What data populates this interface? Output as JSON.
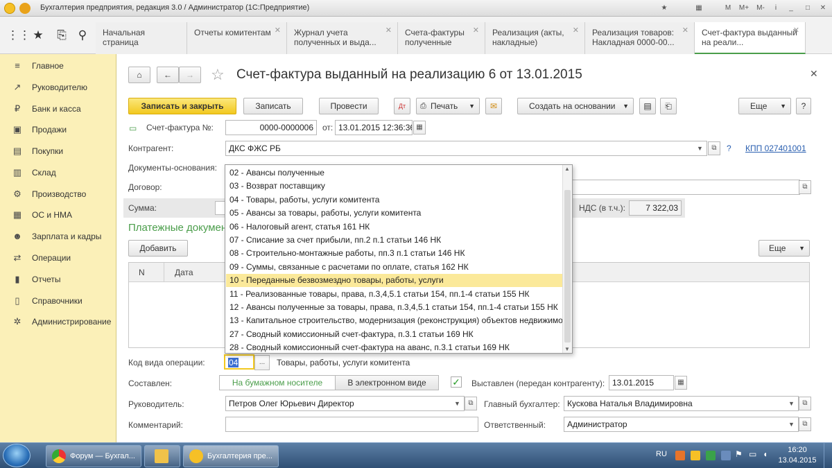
{
  "window": {
    "title": "Бухгалтерия предприятия, редакция 3.0 / Администратор  (1С:Предприятие)",
    "controls": [
      "M",
      "M+",
      "M-"
    ]
  },
  "tabs": [
    {
      "label": "Начальная страница",
      "closable": false
    },
    {
      "label": "Отчеты комитентам",
      "closable": true
    },
    {
      "label": "Журнал учета полученных и выда...",
      "closable": true
    },
    {
      "label": "Счета-фактуры полученные",
      "closable": true
    },
    {
      "label": "Реализация (акты, накладные)",
      "closable": true
    },
    {
      "label": "Реализация товаров: Накладная 0000-00...",
      "closable": true
    },
    {
      "label": "Счет-фактура выданный на реали...",
      "closable": true,
      "active": true
    }
  ],
  "sidebar": {
    "items": [
      {
        "label": "Главное",
        "icon": "list-icon"
      },
      {
        "label": "Руководителю",
        "icon": "chart-icon"
      },
      {
        "label": "Банк и касса",
        "icon": "ruble-icon"
      },
      {
        "label": "Продажи",
        "icon": "cart-icon"
      },
      {
        "label": "Покупки",
        "icon": "basket-icon"
      },
      {
        "label": "Склад",
        "icon": "warehouse-icon"
      },
      {
        "label": "Производство",
        "icon": "factory-icon"
      },
      {
        "label": "ОС и НМА",
        "icon": "building-icon"
      },
      {
        "label": "Зарплата и кадры",
        "icon": "people-icon"
      },
      {
        "label": "Операции",
        "icon": "operations-icon"
      },
      {
        "label": "Отчеты",
        "icon": "bar-chart-icon"
      },
      {
        "label": "Справочники",
        "icon": "book-icon"
      },
      {
        "label": "Администрирование",
        "icon": "gear-icon"
      }
    ]
  },
  "doc": {
    "title": "Счет-фактура выданный на реализацию 6 от 13.01.2015",
    "toolbar": {
      "save_close": "Записать и закрыть",
      "save": "Записать",
      "post": "Провести",
      "print": "Печать",
      "create_based": "Создать на основании",
      "more": "Еще",
      "help": "?"
    },
    "invoice_no_label": "Счет-фактура №:",
    "invoice_no": "0000-0000006",
    "from_label": "от:",
    "from_date": "13.01.2015 12:36:36",
    "contractor_label": "Контрагент:",
    "contractor": "ДКС ФЖС РБ",
    "kpp_help": "?",
    "kpp_link": "КПП 027401001",
    "basis_label": "Документы-основания:",
    "contract_label": "Договор:",
    "sum_label": "Сумма:",
    "vat_label": "НДС (в т.ч.):",
    "vat_value": "7 322,03",
    "payment_docs_title": "Платежные документ",
    "add_button": "Добавить",
    "table_more": "Еще",
    "table_columns": [
      "N",
      "Дата"
    ],
    "op_code_label": "Код вида операции:",
    "op_code": "04",
    "op_code_desc": "Товары, работы, услуги комитента",
    "composed_label": "Составлен:",
    "paper": "На бумажном носителе",
    "electronic": "В электронном виде",
    "issued_label": "Выставлен (передан контрагенту):",
    "issued_date": "13.01.2015",
    "head_label": "Руководитель:",
    "head": "Петров Олег Юрьевич Директор",
    "chief_acc_label": "Главный бухгалтер:",
    "chief_acc": "Кускова Наталья Владимировна",
    "comment_label": "Комментарий:",
    "responsible_label": "Ответственный:",
    "responsible": "Администратор"
  },
  "dropdown": {
    "items": [
      "02 - Авансы полученные",
      "03 - Возврат поставщику",
      "04 - Товары, работы, услуги комитента",
      "05 - Авансы за товары, работы, услуги комитента",
      "06 - Налоговый агент, статья 161 НК",
      "07 - Списание за счет прибыли, пп.2 п.1 статьи 146 НК",
      "08 - Строительно-монтажные работы, пп.3 п.1 статьи 146 НК",
      "09 - Суммы, связанные с расчетами по оплате, статья 162 НК",
      "10 - Переданные безвозмездно товары, работы, услуги",
      "11 - Реализованные товары, права, п.3,4,5.1 статьи 154, пп.1-4 статьи 155 НК",
      "12 - Авансы полученные за товары, права, п.3,4,5.1 статьи 154, пп.1-4 статьи 155 НК",
      "13 - Капитальное строительство, модернизация (реконструкция) объектов недвижимости",
      "27 - Сводный комиссионный счет-фактура, п.3.1 статьи 169 НК",
      "28 - Сводный комиссионный счет-фактура на аванс, п.3.1 статьи 169 НК"
    ],
    "highlighted_index": 8
  },
  "taskbar": {
    "items": [
      {
        "label": "Форум — Бухгал..."
      },
      {
        "label": ""
      },
      {
        "label": "Бухгалтерия пре..."
      }
    ],
    "lang": "RU",
    "time": "16:20",
    "date": "13.04.2015"
  },
  "colors": {
    "sidebar": "#fbf0b8",
    "primary": "#f2c81f",
    "section_title": "#4a9d4a",
    "highlight": "#fbe99a",
    "link": "#2a5fb0"
  }
}
